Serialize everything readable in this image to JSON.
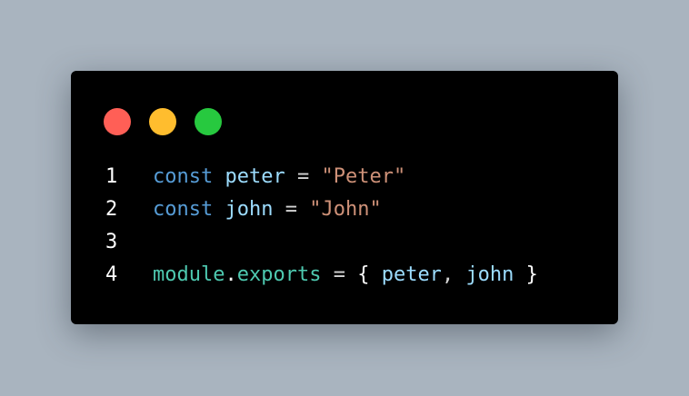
{
  "window": {
    "colors": {
      "close": "#ff5f56",
      "minimize": "#ffbd2e",
      "maximize": "#27c93f"
    }
  },
  "code": {
    "lines": [
      {
        "number": "1",
        "tokens": [
          {
            "t": "const",
            "k": "kw"
          },
          {
            "t": " ",
            "k": "op"
          },
          {
            "t": "peter",
            "k": "var"
          },
          {
            "t": " = ",
            "k": "op"
          },
          {
            "t": "\"Peter\"",
            "k": "str"
          }
        ]
      },
      {
        "number": "2",
        "tokens": [
          {
            "t": "const",
            "k": "kw"
          },
          {
            "t": " ",
            "k": "op"
          },
          {
            "t": "john",
            "k": "var"
          },
          {
            "t": " = ",
            "k": "op"
          },
          {
            "t": "\"John\"",
            "k": "str"
          }
        ]
      },
      {
        "number": "3",
        "tokens": []
      },
      {
        "number": "4",
        "tokens": [
          {
            "t": "module",
            "k": "mod"
          },
          {
            "t": ".",
            "k": "white"
          },
          {
            "t": "exports",
            "k": "mod"
          },
          {
            "t": " = ",
            "k": "op"
          },
          {
            "t": "{ ",
            "k": "white"
          },
          {
            "t": "peter",
            "k": "var"
          },
          {
            "t": ", ",
            "k": "op"
          },
          {
            "t": "john",
            "k": "var"
          },
          {
            "t": " }",
            "k": "white"
          }
        ]
      }
    ]
  }
}
